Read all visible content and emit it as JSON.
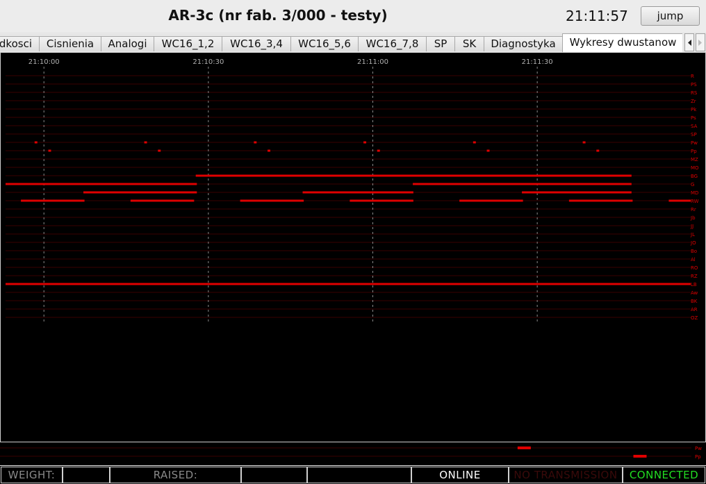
{
  "header": {
    "title": "AR-3c (nr fab. 3/000 - testy)",
    "clock": "21:11:57",
    "jump_label": "jump"
  },
  "tabs": [
    {
      "label": "Predkosci",
      "active": false
    },
    {
      "label": "Cisnienia",
      "active": false
    },
    {
      "label": "Analogi",
      "active": false
    },
    {
      "label": "WC16_1,2",
      "active": false
    },
    {
      "label": "WC16_3,4",
      "active": false
    },
    {
      "label": "WC16_5,6",
      "active": false
    },
    {
      "label": "WC16_7,8",
      "active": false
    },
    {
      "label": "SP",
      "active": false
    },
    {
      "label": "SK",
      "active": false
    },
    {
      "label": "Diagnostyka",
      "active": false
    },
    {
      "label": "Wykresy dwustanow",
      "active": true
    }
  ],
  "tab_scroll": {
    "left_icon": "arrow-left-icon",
    "right_icon": "arrow-right-icon"
  },
  "chart_data": {
    "type": "timeline",
    "x_unit": "time",
    "time_ticks": [
      "21:10:00",
      "21:10:30",
      "21:11:00",
      "21:11:30"
    ],
    "tick_seconds": [
      0,
      30,
      60,
      90
    ],
    "x_range_seconds": [
      -7,
      118
    ],
    "line_color": "#e00000",
    "grid_color": "#3a0000",
    "signals": [
      {
        "name": "R",
        "intervals": []
      },
      {
        "name": "PS",
        "intervals": []
      },
      {
        "name": "RS",
        "intervals": []
      },
      {
        "name": "Zr",
        "intervals": []
      },
      {
        "name": "Pk",
        "intervals": []
      },
      {
        "name": "Ps",
        "intervals": []
      },
      {
        "name": "SA",
        "intervals": []
      },
      {
        "name": "SP",
        "intervals": []
      },
      {
        "name": "Pw",
        "intervals": [
          [
            -1.7,
            -1.2
          ],
          [
            18.3,
            18.8
          ],
          [
            38.3,
            38.8
          ],
          [
            58.3,
            58.8
          ],
          [
            78.3,
            78.8
          ],
          [
            98.3,
            98.8
          ]
        ]
      },
      {
        "name": "Pp",
        "intervals": [
          [
            0.8,
            1.3
          ],
          [
            20.8,
            21.3
          ],
          [
            40.8,
            41.3
          ],
          [
            60.8,
            61.3
          ],
          [
            80.8,
            81.3
          ],
          [
            100.8,
            101.3
          ]
        ]
      },
      {
        "name": "MZ",
        "intervals": []
      },
      {
        "name": "MO",
        "intervals": []
      },
      {
        "name": "BG",
        "intervals": [
          [
            27.7,
            107.2
          ]
        ]
      },
      {
        "name": "G",
        "intervals": [
          [
            -7,
            27.9
          ],
          [
            67.3,
            107.2
          ]
        ]
      },
      {
        "name": "MD",
        "intervals": [
          [
            7.2,
            27.9
          ],
          [
            47.2,
            67.4
          ],
          [
            87.2,
            107.2
          ]
        ]
      },
      {
        "name": "RW",
        "intervals": [
          [
            -4.2,
            7.4
          ],
          [
            15.8,
            27.4
          ],
          [
            35.8,
            47.4
          ],
          [
            55.8,
            67.4
          ],
          [
            75.8,
            87.4
          ],
          [
            95.8,
            107.4
          ],
          [
            114.0,
            118.0
          ]
        ]
      },
      {
        "name": "Rr",
        "intervals": []
      },
      {
        "name": "Jb",
        "intervals": []
      },
      {
        "name": "JJ",
        "intervals": []
      },
      {
        "name": "JL",
        "intervals": []
      },
      {
        "name": "JO",
        "intervals": []
      },
      {
        "name": "Bo",
        "intervals": []
      },
      {
        "name": "Al",
        "intervals": []
      },
      {
        "name": "RO",
        "intervals": []
      },
      {
        "name": "RZ",
        "intervals": []
      },
      {
        "name": "LB",
        "intervals": [
          [
            -7,
            118
          ]
        ]
      },
      {
        "name": "Aw",
        "intervals": []
      },
      {
        "name": "BK",
        "intervals": []
      },
      {
        "name": "AR",
        "intervals": []
      },
      {
        "name": "OZ",
        "intervals": []
      }
    ]
  },
  "mini_chart": {
    "signals": [
      {
        "name": "Pw",
        "marks": [
          0.742
        ]
      },
      {
        "name": "Pp",
        "marks": [
          0.906
        ]
      }
    ]
  },
  "status": {
    "weight_label": "WEIGHT:",
    "weight_value": "",
    "raised_label": "RAISED:",
    "raised_value": "",
    "extra_value": "",
    "online": "ONLINE",
    "transmission": "NO TRANSMISSION",
    "connected": "CONNECTED",
    "colors": {
      "online": "#ffffff",
      "transmission": "#3a0a0a",
      "connected": "#22dd22",
      "label": "#8a8a8a"
    }
  }
}
